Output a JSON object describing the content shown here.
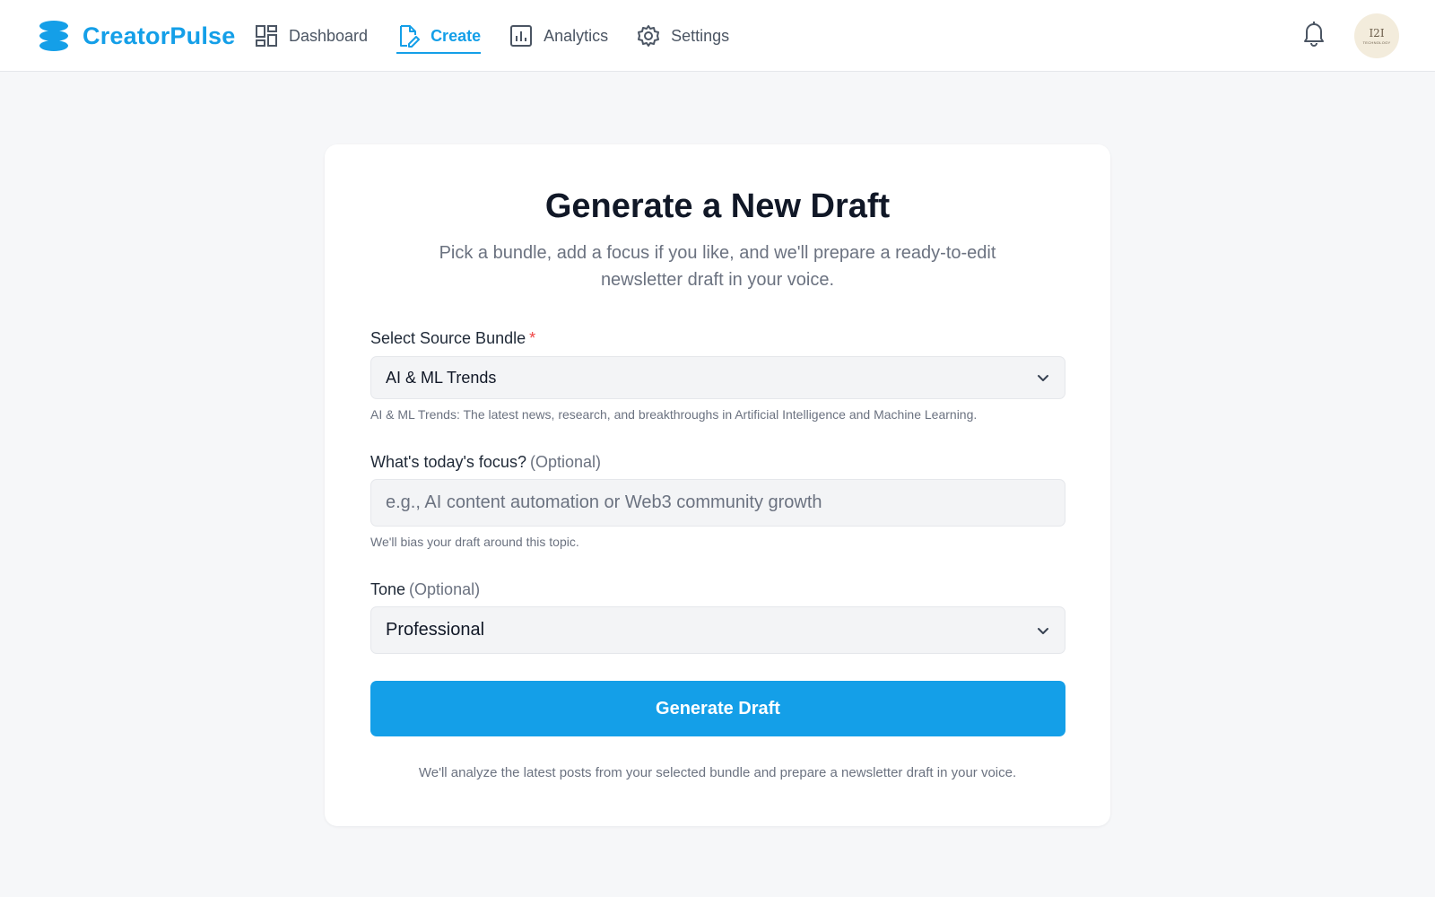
{
  "brand": {
    "name": "CreatorPulse",
    "color": "#149fe8"
  },
  "nav": {
    "items": [
      {
        "label": "Dashboard",
        "icon": "dashboard-icon",
        "active": false
      },
      {
        "label": "Create",
        "icon": "edit-document-icon",
        "active": true
      },
      {
        "label": "Analytics",
        "icon": "bar-chart-icon",
        "active": false
      },
      {
        "label": "Settings",
        "icon": "gear-icon",
        "active": false
      }
    ]
  },
  "header": {
    "notifications_icon": "bell-icon",
    "avatar": {
      "mark": "I2I",
      "sub": "TECHNOLOGY"
    }
  },
  "card": {
    "title": "Generate a New Draft",
    "subtitle": "Pick a bundle, add a focus if you like, and we'll prepare a ready-to-edit newsletter draft in your voice."
  },
  "form": {
    "bundle": {
      "label": "Select Source Bundle",
      "required_mark": "*",
      "value": "AI & ML Trends",
      "help": "AI & ML Trends: The latest news, research, and breakthroughs in Artificial Intelligence and Machine Learning."
    },
    "focus": {
      "label": "What's today's focus?",
      "optional": "(Optional)",
      "placeholder": "e.g., AI content automation or Web3 community growth",
      "value": "",
      "help": "We'll bias your draft around this topic."
    },
    "tone": {
      "label": "Tone",
      "optional": "(Optional)",
      "value": "Professional"
    },
    "submit_label": "Generate Draft",
    "footer_note": "We'll analyze the latest posts from your selected bundle and prepare a newsletter draft in your voice."
  }
}
